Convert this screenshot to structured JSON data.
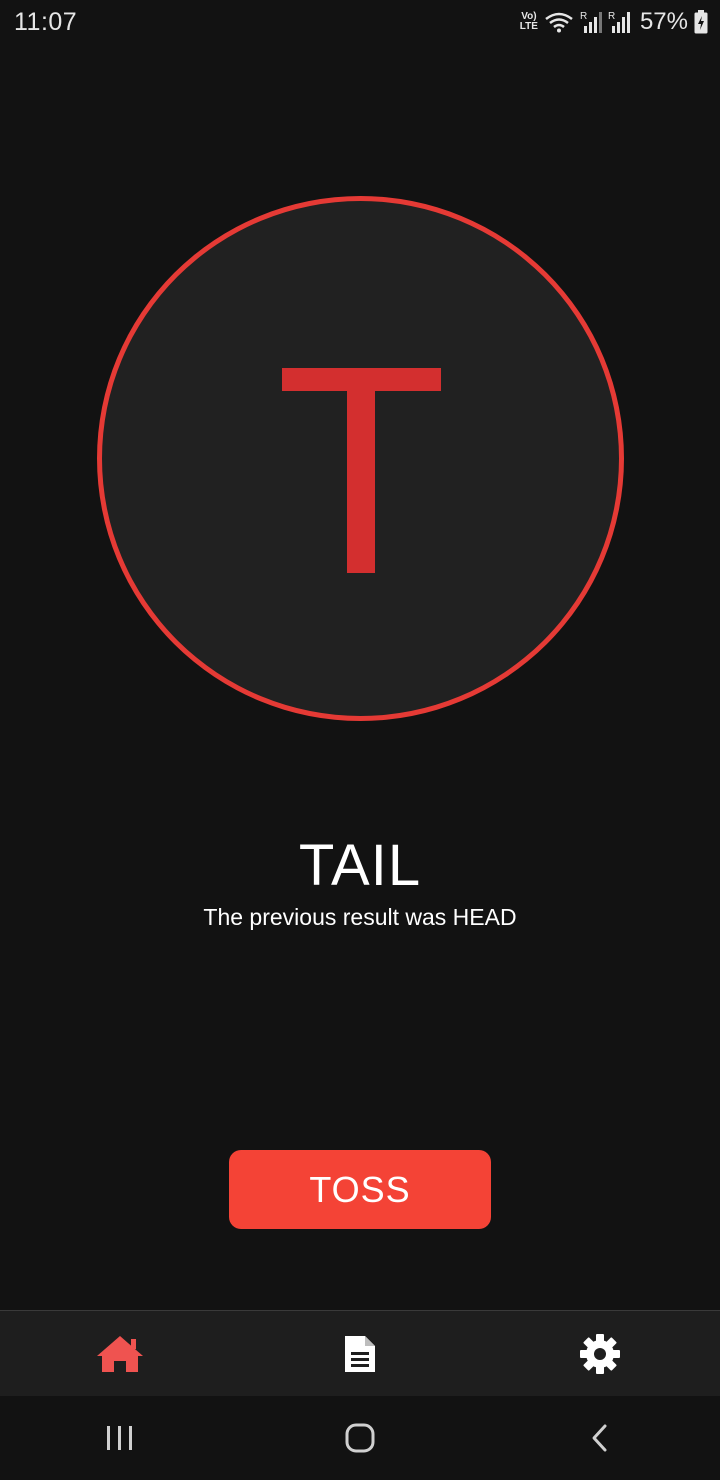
{
  "status_bar": {
    "time": "11:07",
    "volte_top": "Vo)",
    "volte_bottom": "LTE",
    "battery": "57%",
    "icons": [
      "volte-icon",
      "wifi-icon",
      "signal-icon",
      "signal-icon",
      "battery-charging-icon"
    ]
  },
  "coin": {
    "letter": "T",
    "letter_color": "#d32f2f",
    "ring_color": "#e53a35",
    "face_color": "#212121"
  },
  "result": {
    "title": "TAIL",
    "previous": "The previous result was HEAD"
  },
  "toss_button": {
    "label": "TOSS",
    "color": "#f44336"
  },
  "bottom_nav": {
    "items": [
      {
        "icon": "home-icon",
        "active": true,
        "color": "#ef5350"
      },
      {
        "icon": "document-icon",
        "active": false,
        "color": "#ffffff"
      },
      {
        "icon": "gear-icon",
        "active": false,
        "color": "#ffffff"
      }
    ]
  },
  "system_nav": {
    "icons": [
      "recent-apps-icon",
      "home-button-icon",
      "back-icon"
    ]
  }
}
